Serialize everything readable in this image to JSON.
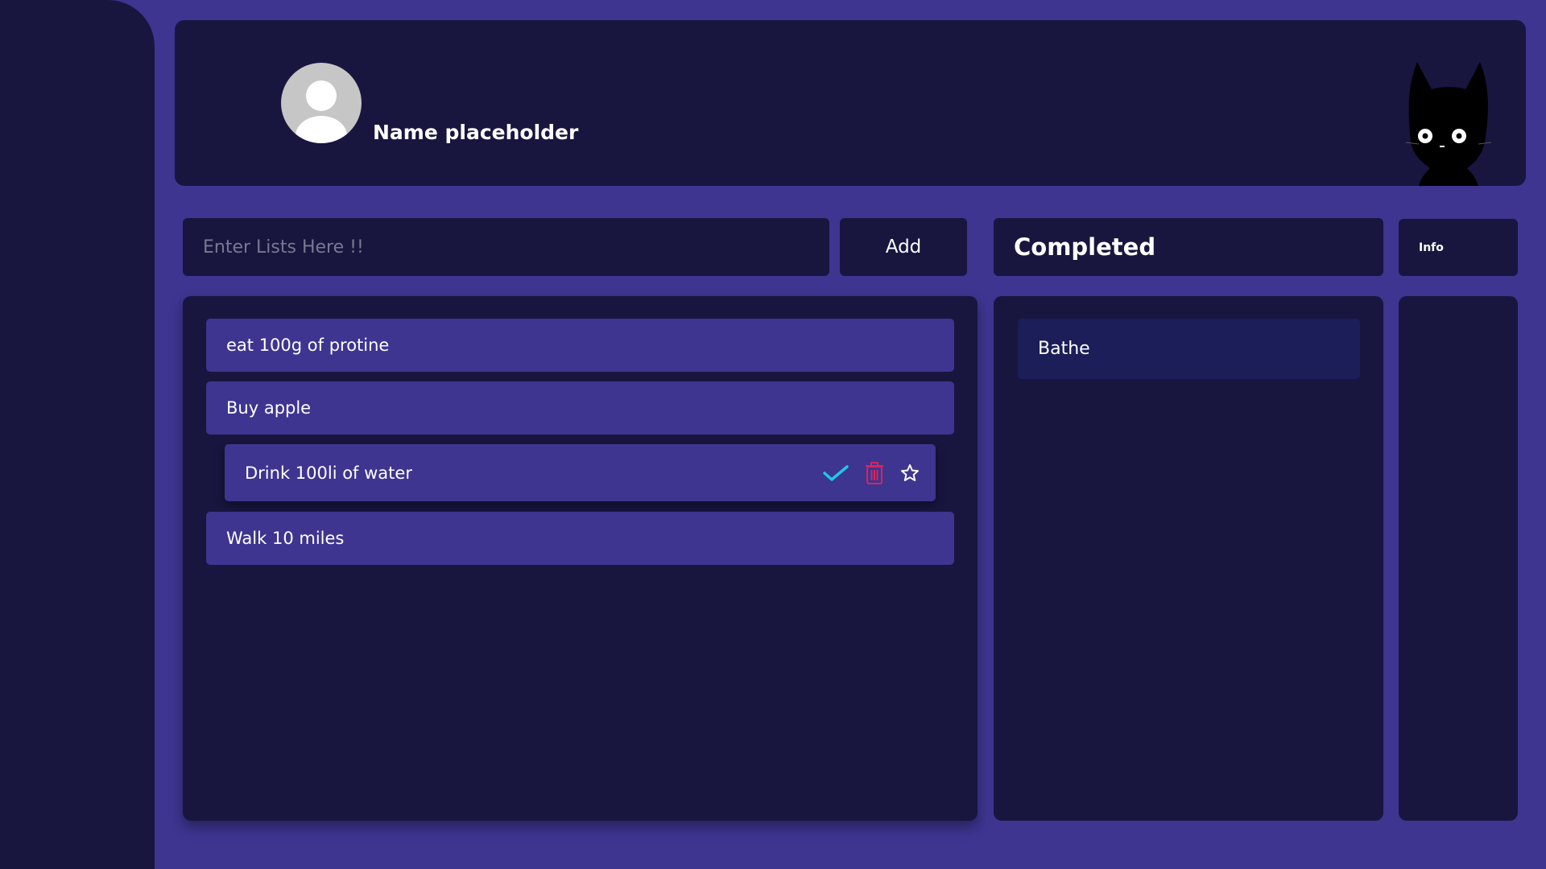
{
  "header": {
    "user_name": "Name placeholder"
  },
  "input": {
    "placeholder": "Enter Lists Here !!",
    "value": ""
  },
  "add_button": {
    "label": "Add"
  },
  "completed": {
    "title": "Completed",
    "items": [
      {
        "text": "Bathe"
      }
    ]
  },
  "info_button": {
    "label": "Info"
  },
  "todos": [
    {
      "text": "eat 100g of protine"
    },
    {
      "text": "Buy apple"
    },
    {
      "text": "Drink 100li of water"
    },
    {
      "text": "Walk 10 miles"
    }
  ],
  "icons": {
    "check": "check-icon",
    "trash": "trash-icon",
    "star": "star-icon",
    "avatar": "avatar-icon",
    "cat": "cat-illustration"
  },
  "colors": {
    "background": "#3d3590",
    "panel": "#18163f",
    "item": "#3d3590",
    "completed_item": "#1b1e59",
    "check": "#1fc6e8",
    "trash": "#d8245e",
    "star": "#ffffff"
  }
}
